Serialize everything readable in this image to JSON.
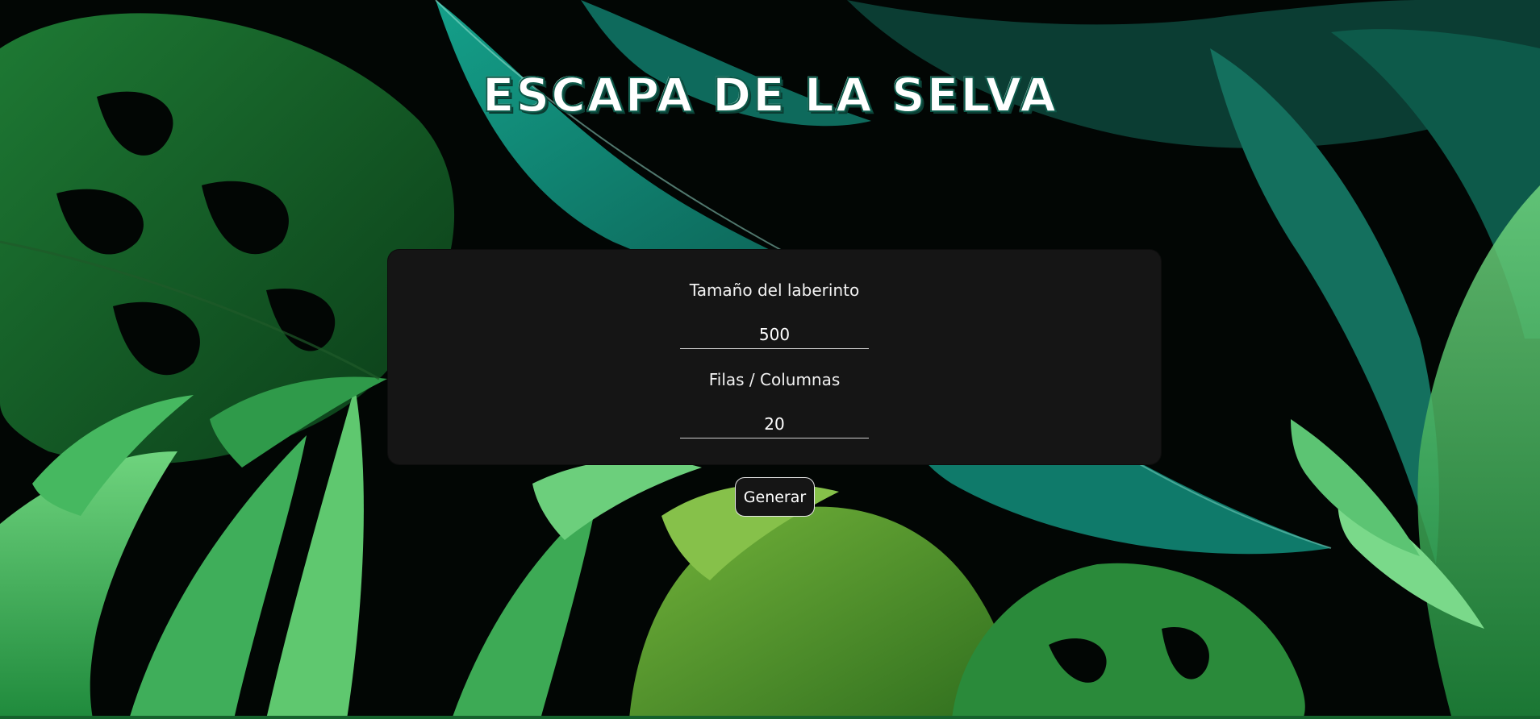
{
  "title": "ESCAPA DE LA SELVA",
  "form": {
    "size_label": "Tamaño del laberinto",
    "size_value": "500",
    "rows_label": "Filas / Columnas",
    "rows_value": "20"
  },
  "actions": {
    "generate_label": "Generar"
  },
  "colors": {
    "panel_background": "#151515",
    "text": "#ffffff",
    "jungle_dark": "#0b4d1f",
    "jungle_teal": "#0f7a6a",
    "jungle_light": "#4fbf6a"
  }
}
